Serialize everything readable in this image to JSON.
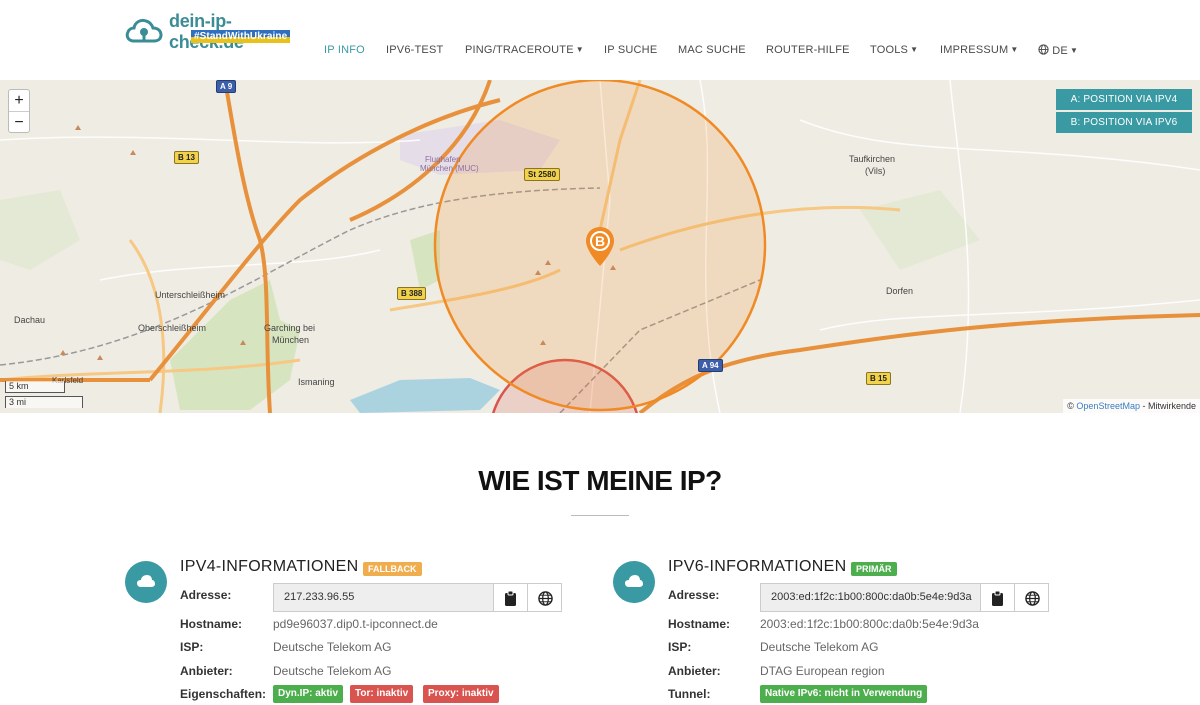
{
  "logo": {
    "name": "dein-ip-check.de",
    "badge": "#StandWithUkraine"
  },
  "nav": {
    "items": [
      {
        "label": "IP INFO",
        "active": true
      },
      {
        "label": "IPV6-TEST"
      },
      {
        "label": "PING/TRACEROUTE",
        "dropdown": true
      },
      {
        "label": "IP SUCHE"
      },
      {
        "label": "MAC SUCHE"
      },
      {
        "label": "ROUTER-HILFE"
      },
      {
        "label": "TOOLS",
        "dropdown": true
      },
      {
        "label": "IMPRESSUM",
        "dropdown": true
      },
      {
        "label": "DE",
        "dropdown": true,
        "icon": "globe-icon"
      }
    ]
  },
  "map": {
    "zoom_in": "+",
    "zoom_out": "−",
    "position_ipv4": "A: POSITION VIA IPV4",
    "position_ipv6": "B: POSITION VIA IPV6",
    "scale_km": "5 km",
    "scale_mi": "3 mi",
    "attribution_prefix": "©",
    "attribution_link": "OpenStreetMap",
    "attribution_suffix": "- Mitwirkende",
    "marker_label": "B",
    "places": [
      "Dachau",
      "Unterschleißheim",
      "Oberschleißheim",
      "Garching bei",
      "München",
      "Ismaning",
      "Karlsfeld",
      "Flughafen",
      "München (MUC)",
      "Taufkirchen",
      "(Vils)",
      "Dorfen"
    ],
    "roads": [
      "A 9",
      "B 13",
      "St 2580",
      "B 388",
      "A 94",
      "B 15",
      "B 388"
    ],
    "colors": {
      "circle_a": "#d9534f",
      "circle_b": "#f08a24",
      "marker": "#f08a24"
    }
  },
  "page": {
    "heading": "WIE IST MEINE IP?"
  },
  "ipv4": {
    "title": "IPV4-INFORMATIONEN",
    "tag": "FALLBACK",
    "address_label": "Adresse:",
    "address": "217.233.96.55",
    "hostname_label": "Hostname:",
    "hostname": "pd9e96037.dip0.t-ipconnect.de",
    "isp_label": "ISP:",
    "isp": "Deutsche Telekom AG",
    "provider_label": "Anbieter:",
    "provider": "Deutsche Telekom AG",
    "props_label": "Eigenschaften:",
    "props": [
      "Dyn.IP: aktiv",
      "Tor: inaktiv",
      "Proxy: inaktiv"
    ]
  },
  "ipv6": {
    "title": "IPV6-INFORMATIONEN",
    "tag": "PRIMÄR",
    "address_label": "Adresse:",
    "address": "2003:ed:1f2c:1b00:800c:da0b:5e4e:9d3a",
    "hostname_label": "Hostname:",
    "hostname": "2003:ed:1f2c:1b00:800c:da0b:5e4e:9d3a",
    "isp_label": "ISP:",
    "isp": "Deutsche Telekom AG",
    "provider_label": "Anbieter:",
    "provider": "DTAG European region",
    "tunnel_label": "Tunnel:",
    "tunnel": "Native IPv6: nicht in Verwendung"
  }
}
